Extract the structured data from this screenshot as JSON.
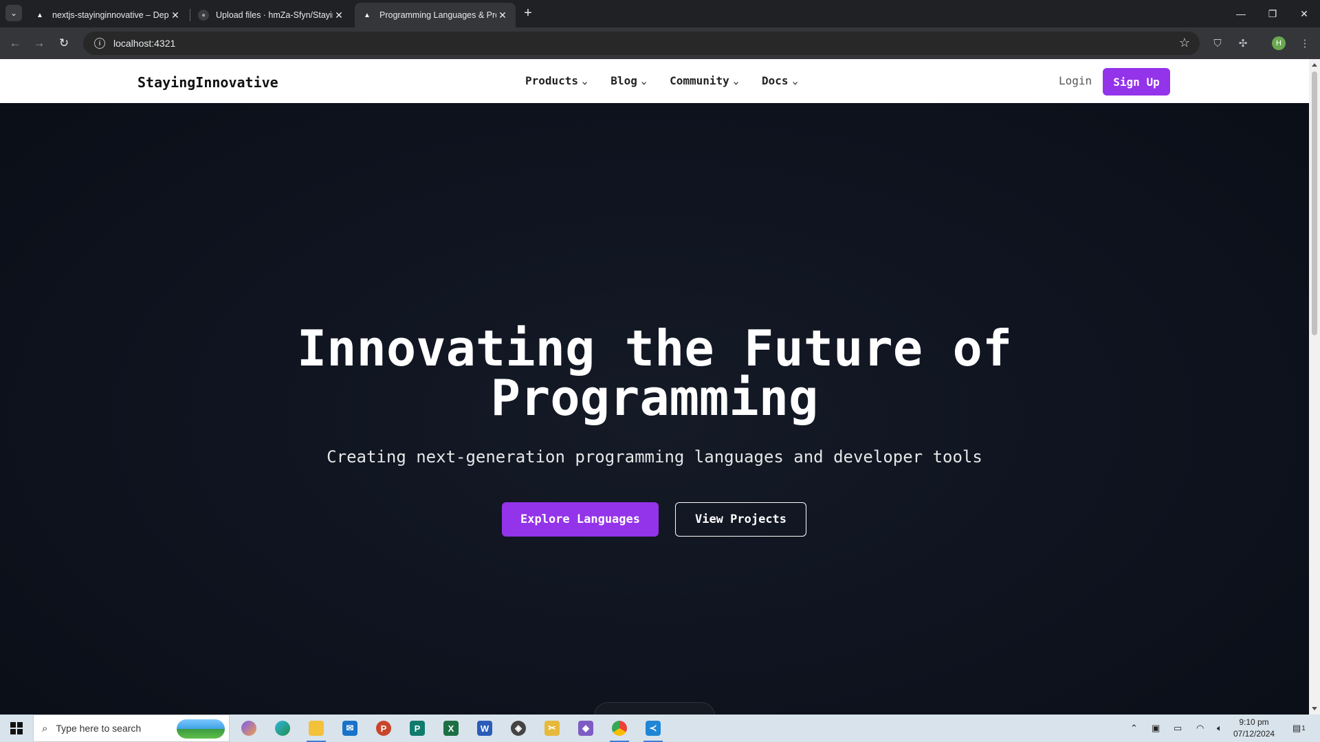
{
  "browser": {
    "tabs": [
      {
        "title": "nextjs-stayinginnovative – Depl",
        "active": false
      },
      {
        "title": "Upload files · hmZa-Sfyn/Stayin",
        "active": false
      },
      {
        "title": "Programming Languages & Pro",
        "active": true
      }
    ],
    "url": "localhost:4321",
    "profile_initial": "H"
  },
  "site": {
    "brand": "StayingInnovative",
    "nav": [
      {
        "label": "Products"
      },
      {
        "label": "Blog"
      },
      {
        "label": "Community"
      },
      {
        "label": "Docs"
      }
    ],
    "login": "Login",
    "signup": "Sign Up"
  },
  "hero": {
    "title_line1": "Innovating the Future of",
    "title_line2": "Programming",
    "subtitle": "Creating next-generation programming languages and developer tools",
    "primary_cta": "Explore Languages",
    "secondary_cta": "View Projects"
  },
  "colors": {
    "accent": "#9333ea",
    "hero_bg": "#0f1420"
  },
  "taskbar": {
    "search_placeholder": "Type here to search",
    "time": "9:10 pm",
    "date": "07/12/2024",
    "notification_count": "1"
  }
}
